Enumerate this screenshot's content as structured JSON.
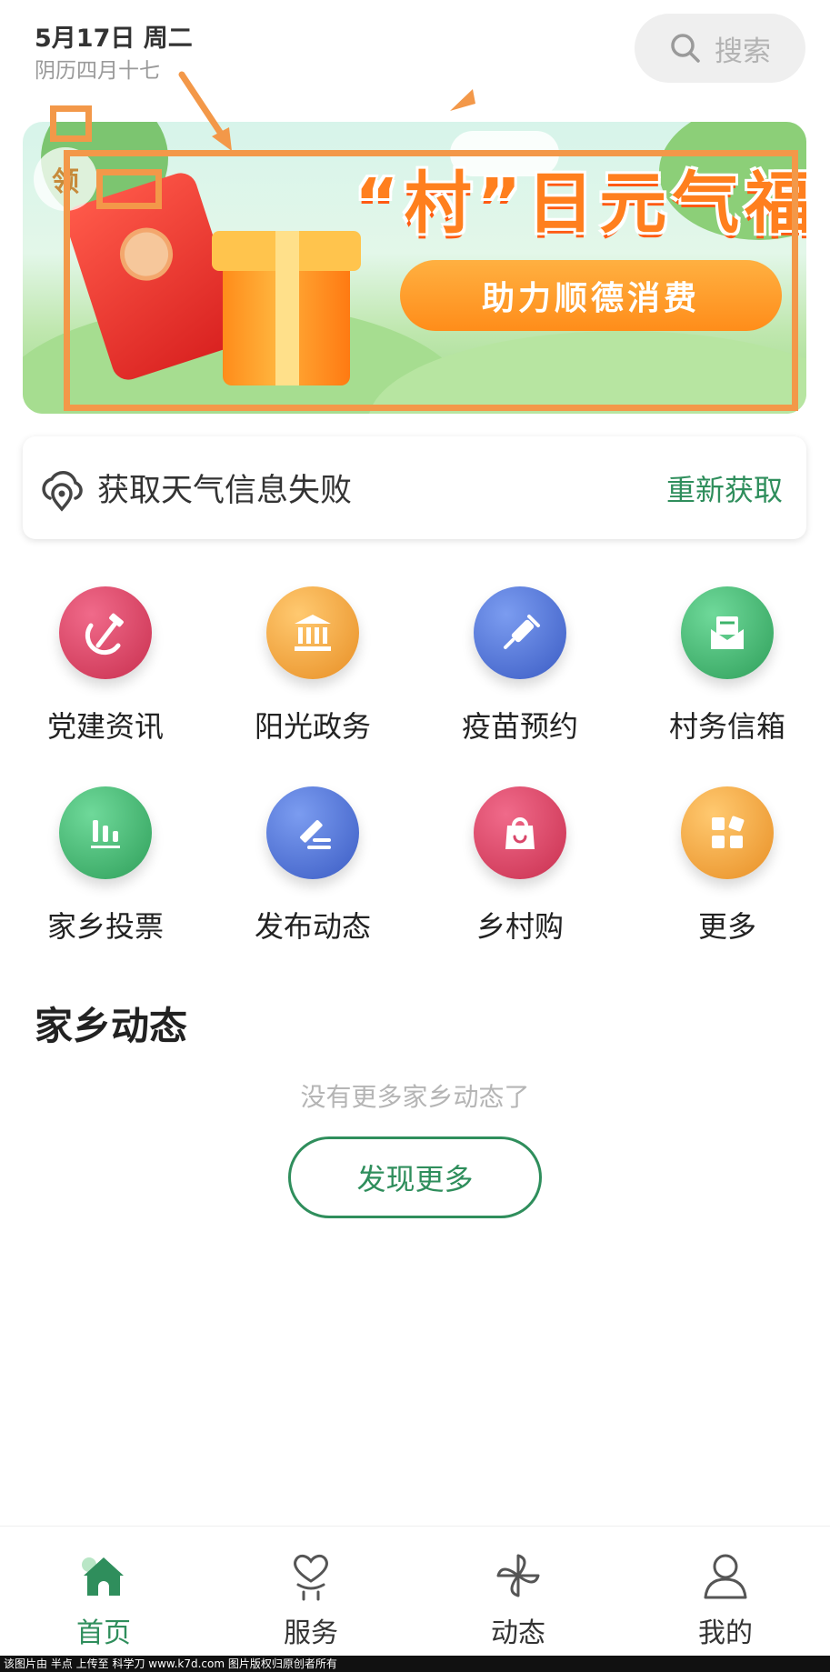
{
  "header": {
    "date": "5月17日 周二",
    "lunar": "阴历四月十七",
    "search_label": "搜索"
  },
  "banner": {
    "headline": "“村”日元气福利",
    "subline": "助力顺德消费",
    "badge": "领"
  },
  "weather": {
    "message": "获取天气信息失败",
    "retry": "重新获取"
  },
  "grid": [
    {
      "label": "党建资讯",
      "icon": "hammer-sickle-icon",
      "color": "#d9466a"
    },
    {
      "label": "阳光政务",
      "icon": "government-building-icon",
      "color": "#f2a23a"
    },
    {
      "label": "疫苗预约",
      "icon": "syringe-icon",
      "color": "#4f73d6"
    },
    {
      "label": "村务信箱",
      "icon": "mailbox-icon",
      "color": "#3db36a"
    },
    {
      "label": "家乡投票",
      "icon": "bar-chart-icon",
      "color": "#3db36a"
    },
    {
      "label": "发布动态",
      "icon": "pencil-icon",
      "color": "#4f73d6"
    },
    {
      "label": "乡村购",
      "icon": "shopping-bag-icon",
      "color": "#d9466a"
    },
    {
      "label": "更多",
      "icon": "more-apps-icon",
      "color": "#f2a23a"
    }
  ],
  "feed": {
    "title": "家乡动态",
    "empty_message": "没有更多家乡动态了",
    "discover_button": "发现更多"
  },
  "bottom_nav": [
    {
      "label": "首页",
      "icon": "home-icon",
      "active": true
    },
    {
      "label": "服务",
      "icon": "heart-hand-icon",
      "active": false
    },
    {
      "label": "动态",
      "icon": "pinwheel-icon",
      "active": false
    },
    {
      "label": "我的",
      "icon": "user-icon",
      "active": false
    }
  ],
  "footer": "该图片由 半点 上传至 科学刀 www.k7d.com 图片版权归原创者所有",
  "colors": {
    "brand_green": "#2f8e5c",
    "annotation_orange": "#f39849"
  }
}
